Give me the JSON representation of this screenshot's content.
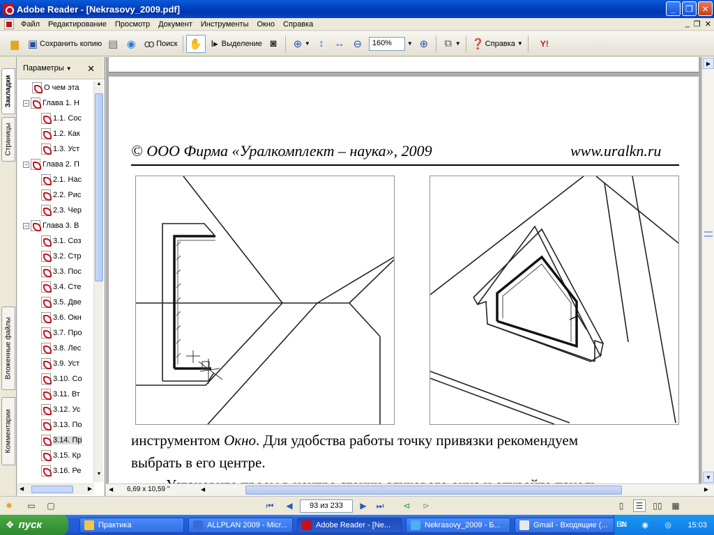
{
  "window": {
    "title": "Adobe Reader - [Nekrasovy_2009.pdf]"
  },
  "menu": [
    "Файл",
    "Редактирование",
    "Просмотр",
    "Документ",
    "Инструменты",
    "Окно",
    "Справка"
  ],
  "toolbar": {
    "save_copy": "Сохранить копию",
    "search": "Поиск",
    "select": "Выделение",
    "zoom": "160%",
    "help": "Справка"
  },
  "side_tabs": [
    "Закладки",
    "Страницы",
    "Вложенные файлы",
    "Комментарии"
  ],
  "nav": {
    "header": "Параметры",
    "bookmarks": [
      {
        "label": "О чем эта",
        "level": 0,
        "expander": ""
      },
      {
        "label": "Глава 1. Н",
        "level": 0,
        "expander": "−"
      },
      {
        "label": "1.1. Сос",
        "level": 1,
        "expander": ""
      },
      {
        "label": "1.2. Как",
        "level": 1,
        "expander": ""
      },
      {
        "label": "1.3. Уст",
        "level": 1,
        "expander": ""
      },
      {
        "label": "Глава 2. П",
        "level": 0,
        "expander": "−"
      },
      {
        "label": "2.1. Нас",
        "level": 1,
        "expander": ""
      },
      {
        "label": "2.2. Рис",
        "level": 1,
        "expander": ""
      },
      {
        "label": "2.3. Чер",
        "level": 1,
        "expander": ""
      },
      {
        "label": "Глава 3. В",
        "level": 0,
        "expander": "−"
      },
      {
        "label": "3.1. Соз",
        "level": 1,
        "expander": ""
      },
      {
        "label": "3.2. Стр",
        "level": 1,
        "expander": ""
      },
      {
        "label": "3.3. Пос",
        "level": 1,
        "expander": ""
      },
      {
        "label": "3.4. Сте",
        "level": 1,
        "expander": ""
      },
      {
        "label": "3.5. Две",
        "level": 1,
        "expander": ""
      },
      {
        "label": "3.6. Окн",
        "level": 1,
        "expander": ""
      },
      {
        "label": "3.7. Про",
        "level": 1,
        "expander": ""
      },
      {
        "label": "3.8. Лес",
        "level": 1,
        "expander": ""
      },
      {
        "label": "3.9. Уст",
        "level": 1,
        "expander": ""
      },
      {
        "label": "3.10. Со",
        "level": 1,
        "expander": ""
      },
      {
        "label": "3.11. Вт",
        "level": 1,
        "expander": ""
      },
      {
        "label": "3.12. Ус",
        "level": 1,
        "expander": ""
      },
      {
        "label": "3.13. По",
        "level": 1,
        "expander": ""
      },
      {
        "label": "3.14. Пр",
        "level": 1,
        "expander": "",
        "selected": true
      },
      {
        "label": "3.15. Кр",
        "level": 1,
        "expander": ""
      },
      {
        "label": "3.16. Ре",
        "level": 1,
        "expander": ""
      }
    ]
  },
  "page": {
    "header_left": "©  ООО Фирма «Уралкомплект – наука», 2009",
    "header_right": "www.uralkn.ru",
    "line1_pre": "инструментом ",
    "line1_em": "Окно",
    "line1_post": ". Для удобства работы точку привязки рекомендуем",
    "line2": "выбрать в его центре.",
    "line3": "Установите проем в центре стенки слухового окна и откройте панель"
  },
  "status": {
    "page_size": "6,69 x 10,59 \"",
    "page_counter": "93 из 233"
  },
  "taskbar": {
    "start": "пуск",
    "tasks": [
      {
        "label": "Практика",
        "color": "#f4c842"
      },
      {
        "label": "ALLPLAN 2009 - Micr...",
        "color": "#3a6ad8"
      },
      {
        "label": "Adobe Reader - [Ne...",
        "color": "#c8101b",
        "active": true
      },
      {
        "label": "Nekrasovy_2009 - Б...",
        "color": "#4ab0f0"
      },
      {
        "label": "Gmail - Входящие (...",
        "color": "#e8e8e8"
      }
    ],
    "lang": "EN",
    "clock": "15:03"
  }
}
